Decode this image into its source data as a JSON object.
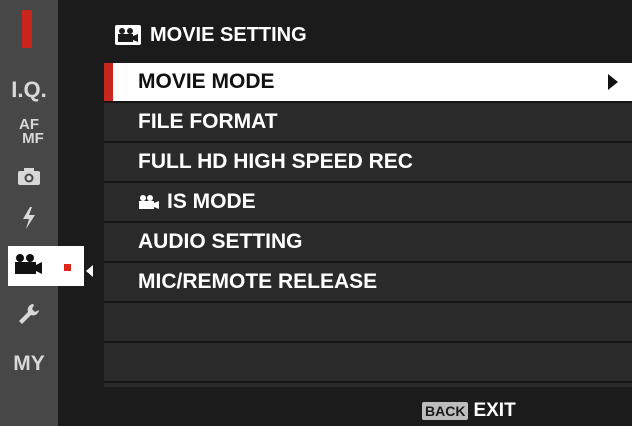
{
  "header": {
    "title": "MOVIE SETTING",
    "icon": "movie-camera-icon"
  },
  "sidebar": {
    "tabs": [
      {
        "label": "I.Q.",
        "icon": null
      },
      {
        "label": "AF\nMF",
        "icon": null
      },
      {
        "label": "",
        "icon": "camera-icon"
      },
      {
        "label": "",
        "icon": "flash-icon"
      },
      {
        "label": "",
        "icon": "movie-camera-icon",
        "active": true
      },
      {
        "label": "",
        "icon": "wrench-icon"
      },
      {
        "label": "MY",
        "icon": null
      }
    ]
  },
  "menu": {
    "items": [
      {
        "label": "MOVIE MODE",
        "selected": true,
        "has_submenu": true
      },
      {
        "label": "FILE FORMAT"
      },
      {
        "label": "FULL HD HIGH SPEED REC"
      },
      {
        "label": "IS MODE",
        "icon": "movie-camera-icon"
      },
      {
        "label": "AUDIO SETTING"
      },
      {
        "label": "MIC/REMOTE RELEASE"
      },
      {
        "label": ""
      },
      {
        "label": ""
      }
    ]
  },
  "footer": {
    "back_key": "BACK",
    "exit_label": "EXIT"
  },
  "colors": {
    "accent": "#c8261c",
    "background": "#1b1b1b",
    "rail": "#474747"
  }
}
